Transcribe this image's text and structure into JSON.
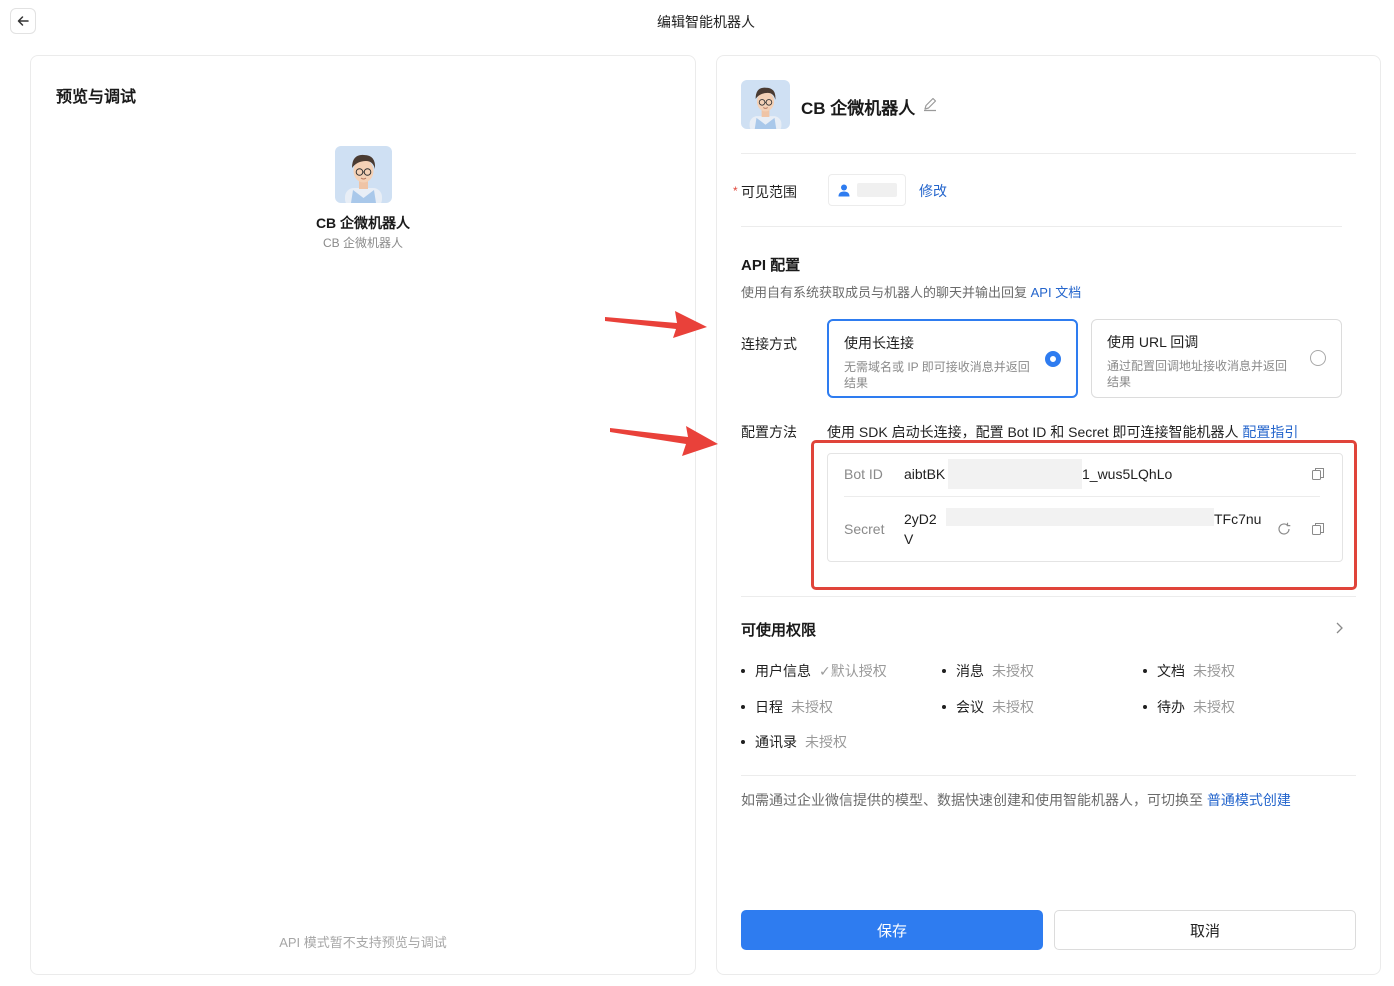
{
  "header": {
    "title": "编辑智能机器人"
  },
  "preview": {
    "title": "预览与调试",
    "bot_name": "CB 企微机器人",
    "bot_subtitle": "CB 企微机器人",
    "footer_note": "API 模式暂不支持预览与调试"
  },
  "bot": {
    "name": "CB 企微机器人"
  },
  "visibility": {
    "label": "可见范围",
    "edit_link": "修改"
  },
  "api_config": {
    "title": "API 配置",
    "description": "使用自有系统获取成员与机器人的聊天并输出回复",
    "doc_link": "API 文档",
    "connection_label": "连接方式",
    "options": [
      {
        "title": "使用长连接",
        "desc": "无需域名或 IP 即可接收消息并返回结果",
        "selected": true
      },
      {
        "title": "使用 URL 回调",
        "desc": "通过配置回调地址接收消息并返回结果",
        "selected": false
      }
    ],
    "method_label": "配置方法",
    "method_text": "使用 SDK 启动长连接，配置 Bot ID 和 Secret 即可连接智能机器人",
    "guide_link": "配置指引",
    "bot_id_label": "Bot ID",
    "bot_id_prefix": "aibtBK",
    "bot_id_suffix": "1_wus5LQhLo",
    "secret_label": "Secret",
    "secret_prefix": "2yD2",
    "secret_suffix": "TFc7nu",
    "secret_line2": "V"
  },
  "permissions": {
    "title": "可使用权限",
    "items": [
      {
        "name": "用户信息",
        "status": "默认授权",
        "check": "✓"
      },
      {
        "name": "消息",
        "status": "未授权"
      },
      {
        "name": "文档",
        "status": "未授权"
      },
      {
        "name": "日程",
        "status": "未授权"
      },
      {
        "name": "会议",
        "status": "未授权"
      },
      {
        "name": "待办",
        "status": "未授权"
      },
      {
        "name": "通讯录",
        "status": "未授权"
      }
    ]
  },
  "footer_hint": {
    "text": "如需通过企业微信提供的模型、数据快速创建和使用智能机器人，可切换至",
    "link": "普通模式创建"
  },
  "actions": {
    "save": "保存",
    "cancel": "取消"
  },
  "colors": {
    "primary": "#2e7cf0",
    "link": "#2465cc",
    "annotation_red": "#e0443a"
  }
}
